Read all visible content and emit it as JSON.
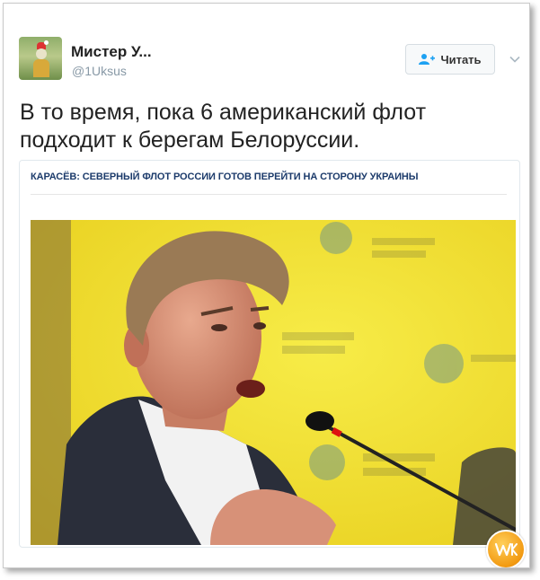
{
  "author": {
    "display_name": "Мистер У...",
    "handle": "@1Uksus"
  },
  "follow_button": {
    "label": "Читать"
  },
  "tweet": {
    "text": "В то время, пока 6 американский флот подходит к берегам Белоруссии."
  },
  "card": {
    "headline": "КАРАСЁВ: СЕВЕРНЫЙ ФЛОТ РОССИИ ГОТОВ ПЕРЕЙТИ НА СТОРОНУ УКРАИНЫ"
  },
  "colors": {
    "photo_background": "#f3e43a",
    "headline": "#1c3b6b",
    "handle": "#8899a6"
  },
  "icons": {
    "follow": "person-add-icon",
    "menu": "chevron-down-icon",
    "watermark": "site-logo-watermark"
  }
}
